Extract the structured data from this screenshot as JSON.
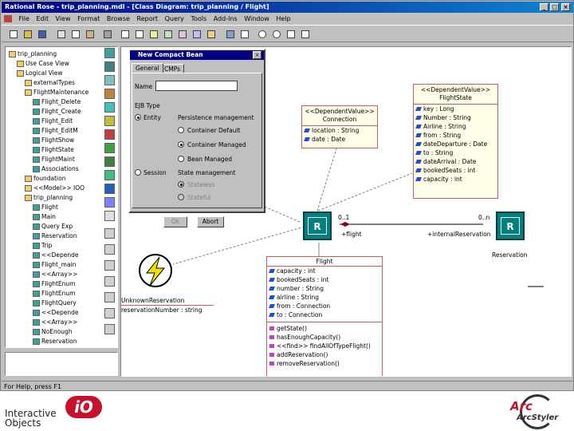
{
  "window": {
    "title": "Rational Rose - trip_planning.mdl - [Class Diagram: trip_planning / Flight]",
    "controls": [
      "_",
      "□",
      "×"
    ]
  },
  "menu": [
    "File",
    "Edit",
    "View",
    "Format",
    "Browse",
    "Report",
    "Query",
    "Tools",
    "Add-Ins",
    "Window",
    "Help"
  ],
  "browser": {
    "items": [
      {
        "label": "trip_planning",
        "indent": 0
      },
      {
        "label": "Use Case View",
        "indent": 1
      },
      {
        "label": "Logical View",
        "indent": 1
      },
      {
        "label": "externalTypes",
        "indent": 2
      },
      {
        "label": "FlightMaintenance",
        "indent": 2
      },
      {
        "label": "Flight_Delete",
        "indent": 3
      },
      {
        "label": "Flight_Create",
        "indent": 3
      },
      {
        "label": "Flight_Edit",
        "indent": 3
      },
      {
        "label": "Flight_EditM",
        "indent": 3
      },
      {
        "label": "FlightShow",
        "indent": 3
      },
      {
        "label": "FlightState",
        "indent": 3
      },
      {
        "label": "FlightMaint",
        "indent": 3
      },
      {
        "label": "Associations",
        "indent": 3
      },
      {
        "label": "foundation",
        "indent": 2
      },
      {
        "label": "<<Model>> IOO",
        "indent": 2
      },
      {
        "label": "trip_planning",
        "indent": 2
      },
      {
        "label": "Flight",
        "indent": 3
      },
      {
        "label": "Main",
        "indent": 3
      },
      {
        "label": "Query Exp",
        "indent": 3
      },
      {
        "label": "Reservation",
        "indent": 3
      },
      {
        "label": "Trip",
        "indent": 3
      },
      {
        "label": "<<Depende",
        "indent": 3
      },
      {
        "label": "Flight_main",
        "indent": 3
      },
      {
        "label": "<<Array>>",
        "indent": 3
      },
      {
        "label": "FlightEnum",
        "indent": 3
      },
      {
        "label": "FlightEnum",
        "indent": 3
      },
      {
        "label": "FlightQuery",
        "indent": 3
      },
      {
        "label": "<<Depende",
        "indent": 3
      },
      {
        "label": "<<Array>>",
        "indent": 3
      },
      {
        "label": "NoEnough",
        "indent": 3
      },
      {
        "label": "Reservation",
        "indent": 3
      }
    ]
  },
  "status": "For Help, press F1",
  "dialog": {
    "title": "New Compact Bean",
    "tabs": [
      "General",
      "CMPs"
    ],
    "name_label": "Name",
    "name_value": "",
    "ejb_type_label": "EJB Type",
    "entity_label": "Entity",
    "persistence_label": "Persistence management",
    "cmp_default_label": "Container Default",
    "container_managed_label": "Container Managed",
    "bean_managed_label": "Bean Managed",
    "session_label": "Session",
    "state_mgmt_label": "State management",
    "stateless_label": "Stateless",
    "stateful_label": "Stateful",
    "ok_label": "Ok",
    "abort_label": "Abort"
  },
  "diagram": {
    "connection": {
      "stereotype": "<<DependentValue>>",
      "name": "Connection",
      "attributes": [
        "location : String",
        "date : Date"
      ]
    },
    "flight_state": {
      "stereotype": "<<DependentValue>>",
      "name": "FlightState",
      "attributes": [
        "key : Long",
        "Number : String",
        "Airline : String",
        "from : String",
        "dateDeparture : Date",
        "to : String",
        "dateArrival : Date",
        "bookedSeats : int",
        "capacity : int"
      ]
    },
    "flight": {
      "name": "Flight",
      "attributes": [
        "capacity : int",
        "bookedSeats : int",
        "number : String",
        "airline : String",
        "from : Connection",
        "to : Connection"
      ],
      "operations": [
        "getState()",
        "hasEnoughCapacity()",
        "<<find>> findAllOfTypeFlight()",
        "addReservation()",
        "removeReservation()"
      ]
    },
    "unknown": {
      "name": "UnknownReservation",
      "attributes": [
        "reservationNumber : string"
      ]
    },
    "r_label": "R",
    "role_flight": "+flight",
    "mult_1": "0..1",
    "mult_n": "0..n",
    "role_res": "+internalReservation",
    "reservation_name": "Reservation"
  },
  "footer": {
    "left_logo": "Interactive Objects",
    "left_mark": "iO",
    "right_logo": "ArcStyler",
    "right_mark": "Arc"
  },
  "colors": {
    "title_bar": "#000080",
    "canvas": "#ffffff",
    "r_component": "#008080",
    "class_border": "#c06060",
    "logo_red": "#c8102e"
  }
}
